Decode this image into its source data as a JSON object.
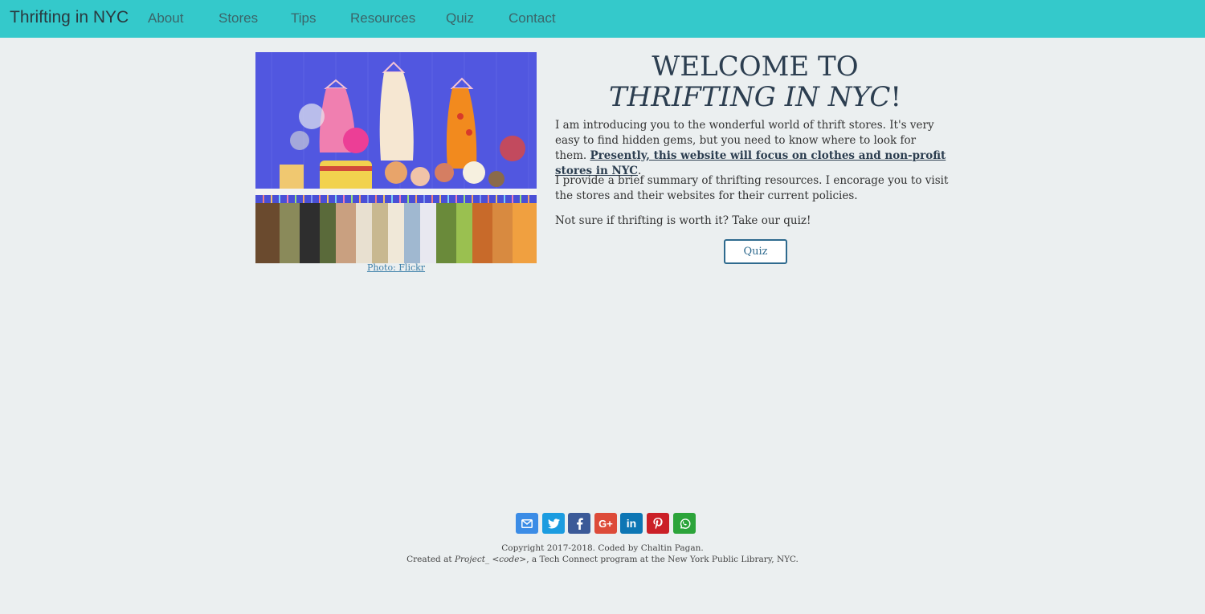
{
  "navbar": {
    "brand": "Thrifting in NYC",
    "links": [
      "About",
      "Stores",
      "Tips",
      "Resources",
      "Quiz",
      "Contact"
    ]
  },
  "hero": {
    "caption": "Photo: Flickr",
    "heading_line1": "WELCOME TO",
    "heading_line2_italic": "THRIFTING IN NYC",
    "heading_exclaim": "!",
    "paragraph1_text": "I am introducing you to the wonderful world of thrift stores. It's very easy to find hidden gems, but you need to know where to look for them. ",
    "paragraph1_link": "Presently, this website will focus on clothes and non-profit stores in NYC",
    "paragraph1_end": ".",
    "paragraph2": "I provide a brief summary of thrifting resources. I encorage you to visit the stores and their websites for their current policies.",
    "paragraph3": "Not sure if thrifting is worth it? Take our quiz!",
    "quiz_button": "Quiz"
  },
  "share_buttons": [
    {
      "icon": "email-icon",
      "glyph": "✉",
      "color": "#3b8ce6"
    },
    {
      "icon": "twitter-icon",
      "glyph": "",
      "color": "#1b9ce0"
    },
    {
      "icon": "facebook-icon",
      "glyph": "f",
      "color": "#3b5a98"
    },
    {
      "icon": "google-plus-icon",
      "glyph": "G+",
      "color": "#dd4b39"
    },
    {
      "icon": "linkedin-icon",
      "glyph": "in",
      "color": "#0d76b4"
    },
    {
      "icon": "pinterest-icon",
      "glyph": "P",
      "color": "#cb2027"
    },
    {
      "icon": "whatsapp-icon",
      "glyph": "",
      "color": "#2ca43a"
    }
  ],
  "footer": {
    "copyright": "Copyright 2017-2018. Coded by Chaltin Pagan.",
    "created_prefix": "Created at ",
    "created_project": "Project_ <code>",
    "created_suffix": ", a Tech Connect program at the New York Public Library, NYC."
  }
}
